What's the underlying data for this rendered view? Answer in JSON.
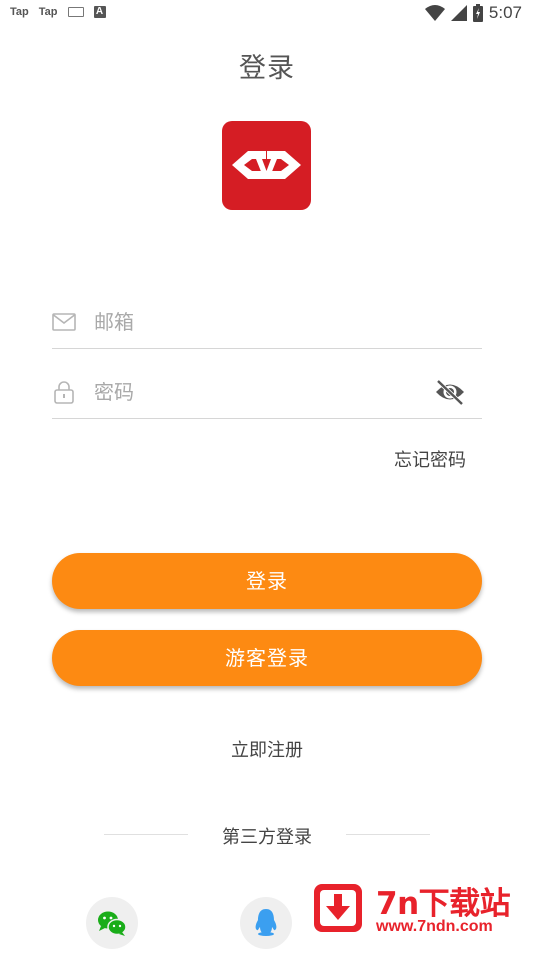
{
  "status_bar": {
    "left_icons": [
      "Tap",
      "Tap"
    ],
    "ime_icon": "keyboard-icon",
    "a_badge": "A",
    "time": "5:07"
  },
  "page": {
    "title": "登录"
  },
  "logo": {
    "icon": "app-logo-icon",
    "color": "#d51d24"
  },
  "form": {
    "email": {
      "placeholder": "邮箱",
      "value": "",
      "icon": "mail-icon"
    },
    "password": {
      "placeholder": "密码",
      "value": "",
      "icon": "lock-icon",
      "toggle_icon": "eye-off-icon"
    },
    "forgot_label": "忘记密码"
  },
  "buttons": {
    "login_label": "登录",
    "guest_label": "游客登录",
    "accent": "#fd8a12"
  },
  "register_label": "立即注册",
  "third_party": {
    "label": "第三方登录",
    "providers": [
      {
        "name": "wechat",
        "icon": "wechat-icon",
        "color": "#1aad19"
      },
      {
        "name": "qq",
        "icon": "qq-icon",
        "color": "#3b9ff0"
      }
    ]
  },
  "watermark": {
    "title": "7n下载站",
    "url": "www.7ndn.com",
    "color": "#e8222b"
  }
}
